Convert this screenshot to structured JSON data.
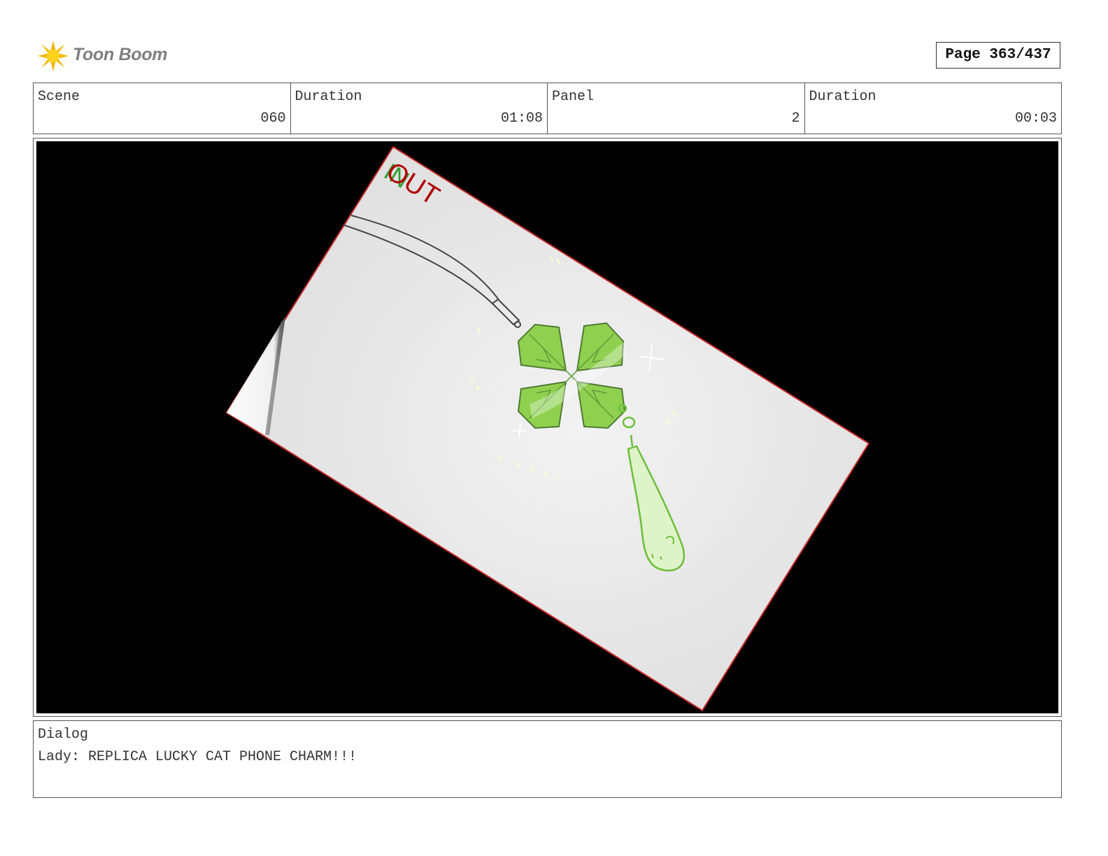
{
  "header": {
    "logo_text": "Toon Boom",
    "page_label": "Page 363/437"
  },
  "info": {
    "scene_label": "Scene",
    "scene_value": "060",
    "scene_duration_label": "Duration",
    "scene_duration_value": "01:08",
    "panel_label": "Panel",
    "panel_value": "2",
    "panel_duration_label": "Duration",
    "panel_duration_value": "00:03"
  },
  "panel": {
    "in_mark": "IN",
    "out_mark": "OUT",
    "colors": {
      "background": "#000000",
      "paper": "#e6e6e6",
      "frame_edge": "#c62828",
      "clover": "#8fd14f",
      "charm": "#dff3c9",
      "sketch_line": "#444444",
      "in_mark": "#2e9e2e",
      "out_mark": "#b00000"
    }
  },
  "dialog": {
    "label": "Dialog",
    "text": "Lady: REPLICA LUCKY CAT PHONE CHARM!!!"
  }
}
